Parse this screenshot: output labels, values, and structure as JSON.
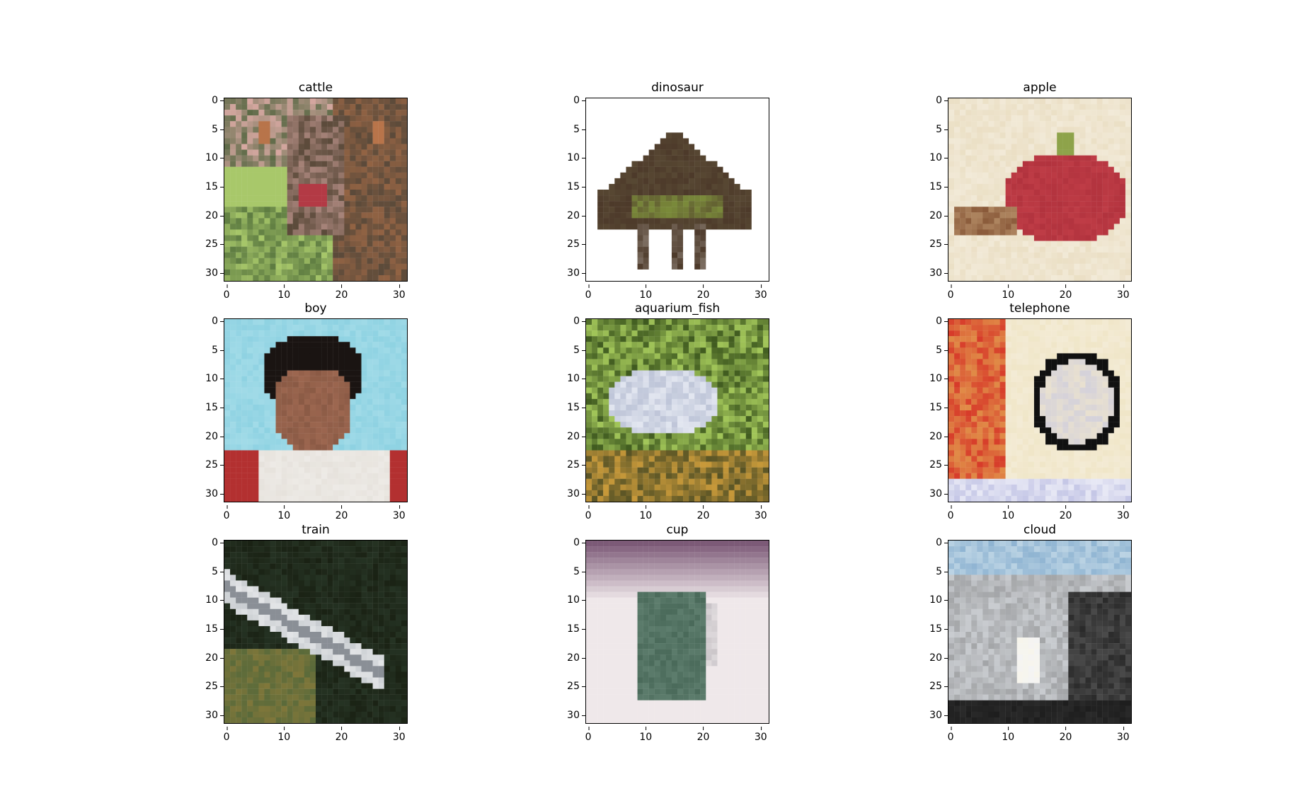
{
  "figure": {
    "panels": [
      {
        "title": "cattle",
        "picture": "cattle photo",
        "palette": [
          "#5b4a3a",
          "#8aa05a",
          "#b8744a",
          "#d9a9a3",
          "#3d5a2f",
          "#a8c86a"
        ]
      },
      {
        "title": "dinosaur",
        "picture": "dinosaur toy",
        "palette": [
          "#ffffff",
          "#4d3a2a",
          "#7a8a3a",
          "#5a4b35",
          "#e7e3df"
        ]
      },
      {
        "title": "apple",
        "picture": "apple still life",
        "palette": [
          "#f2ead8",
          "#b2333e",
          "#8a5a3a",
          "#e6d8b8",
          "#c7a37a"
        ]
      },
      {
        "title": "boy",
        "picture": "boy portrait",
        "palette": [
          "#8ed2e2",
          "#1a1412",
          "#8a5a45",
          "#b33030",
          "#e6e2dc"
        ]
      },
      {
        "title": "aquarium_fish",
        "picture": "aquarium fish",
        "palette": [
          "#3f5a1f",
          "#a3c75a",
          "#e2e6f0",
          "#c99a3a",
          "#26341c"
        ]
      },
      {
        "title": "telephone",
        "picture": "rotary telephone",
        "palette": [
          "#d73b2a",
          "#f0e6c8",
          "#111111",
          "#e7c05a",
          "#c4c6e6"
        ]
      },
      {
        "title": "train",
        "picture": "train",
        "palette": [
          "#1a2214",
          "#c8ccd0",
          "#5a6a3a",
          "#8a7a3a",
          "#2a3a2a"
        ]
      },
      {
        "title": "cup",
        "picture": "cup",
        "palette": [
          "#7c5a77",
          "#efe8ea",
          "#4a6a5a",
          "#c8c3c7",
          "#f7f3f3"
        ]
      },
      {
        "title": "cloud",
        "picture": "cloud",
        "palette": [
          "#8fb4d2",
          "#c9ccd0",
          "#2a2a2a",
          "#f4f4f4",
          "#6a6a6a"
        ]
      }
    ],
    "yticks": [
      "0",
      "5",
      "10",
      "15",
      "20",
      "25",
      "30"
    ],
    "xticks": [
      "0",
      "10",
      "20",
      "30"
    ]
  }
}
